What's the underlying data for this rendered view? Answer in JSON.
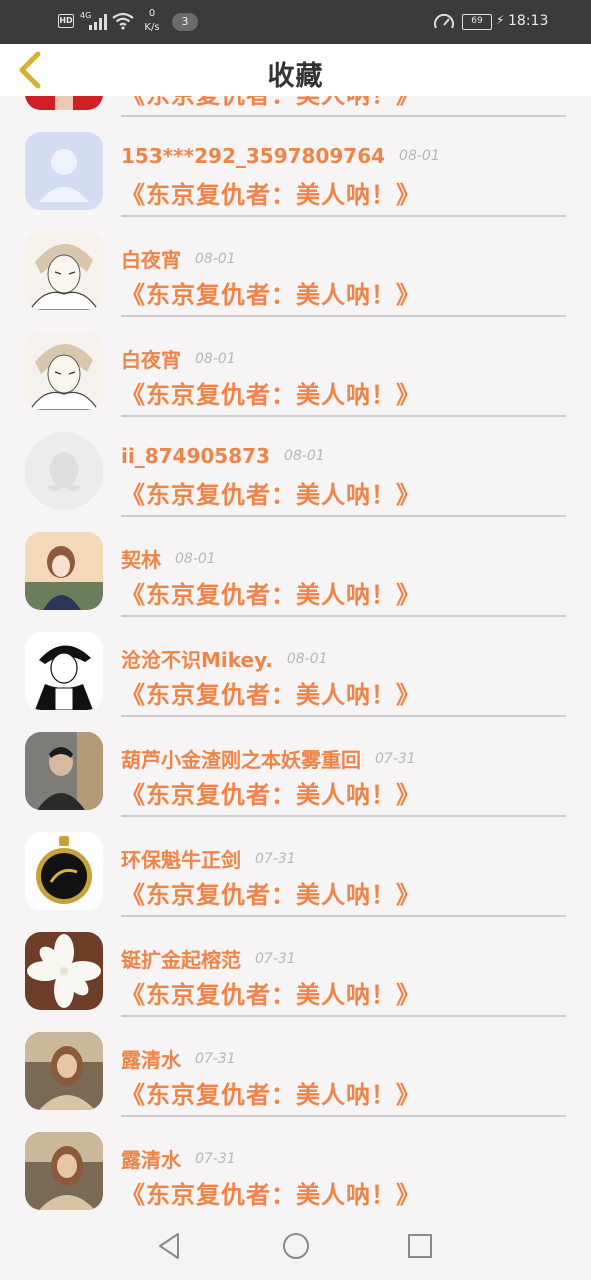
{
  "status_bar": {
    "hd": "HD",
    "network": "4G",
    "speed_value": "0",
    "speed_unit": "K/s",
    "notification_count": "3",
    "battery": "69",
    "time": "18:13"
  },
  "header": {
    "title": "收藏"
  },
  "items": [
    {
      "name": "",
      "date": "",
      "title": "《东京复仇者：美人呐！》",
      "avatar": "partial-red-avatar"
    },
    {
      "name": "153***292_3597809764",
      "date": "08-01",
      "title": "《东京复仇者：美人呐！》",
      "avatar": "default-person-avatar"
    },
    {
      "name": "白夜宵",
      "date": "08-01",
      "title": "《东京复仇者：美人呐！》",
      "avatar": "anime-sketch-avatar"
    },
    {
      "name": "白夜宵",
      "date": "08-01",
      "title": "《东京复仇者：美人呐！》",
      "avatar": "anime-sketch-avatar"
    },
    {
      "name": "ii_874905873",
      "date": "08-01",
      "title": "《东京复仇者：美人呐！》",
      "avatar": "default-penguin-avatar"
    },
    {
      "name": "契林",
      "date": "08-01",
      "title": "《东京复仇者：美人呐！》",
      "avatar": "anime-girl-avatar"
    },
    {
      "name": "沧沧不识Mikey.",
      "date": "08-01",
      "title": "《东京复仇者：美人呐！》",
      "avatar": "manga-boy-avatar"
    },
    {
      "name": "葫芦小金渣刚之本妖雾重回",
      "date": "07-31",
      "title": "《东京复仇者：美人呐！》",
      "avatar": "photo-boy-avatar"
    },
    {
      "name": "环保魁牛正剑",
      "date": "07-31",
      "title": "《东京复仇者：美人呐！》",
      "avatar": "gold-watch-avatar"
    },
    {
      "name": "铤扩金起榕范",
      "date": "07-31",
      "title": "《东京复仇者：美人呐！》",
      "avatar": "white-flower-avatar"
    },
    {
      "name": "露清水",
      "date": "07-31",
      "title": "《东京复仇者：美人呐！》",
      "avatar": "photo-girl-avatar"
    },
    {
      "name": "露清水",
      "date": "07-31",
      "title": "《东京复仇者：美人呐！》",
      "avatar": "photo-girl-avatar"
    }
  ],
  "colors": {
    "accent": "#ef8448",
    "date": "#b8b8b8",
    "divider": "#cfcfcf",
    "back_arrow": "#d6b230",
    "status_bar": "#3b3b3b"
  }
}
